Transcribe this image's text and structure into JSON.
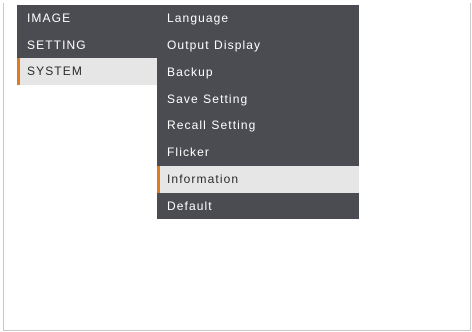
{
  "left_menu": {
    "items": [
      {
        "label": "IMAGE",
        "selected": false
      },
      {
        "label": "SETTING",
        "selected": false
      },
      {
        "label": "SYSTEM",
        "selected": true
      }
    ]
  },
  "submenu": {
    "items": [
      {
        "label": "Language",
        "selected": false
      },
      {
        "label": "Output Display",
        "selected": false
      },
      {
        "label": "Backup",
        "selected": false
      },
      {
        "label": "Save Setting",
        "selected": false
      },
      {
        "label": "Recall Setting",
        "selected": false
      },
      {
        "label": "Flicker",
        "selected": false
      },
      {
        "label": "Information",
        "selected": true
      },
      {
        "label": "Default",
        "selected": false
      }
    ]
  },
  "colors": {
    "menu_background": "#4b4b52",
    "selected_background": "#e6e6e6",
    "accent": "#e07a1f",
    "text": "#ffffff",
    "selected_text": "#2a2a2a"
  }
}
